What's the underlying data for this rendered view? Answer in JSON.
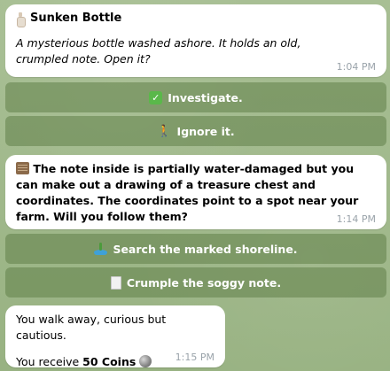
{
  "messages": [
    {
      "title": "Sunken Bottle",
      "text": "A mysterious bottle washed ashore. It holds an old, crumpled note. Open it?",
      "time": "1:04 PM",
      "icon": "bottle-icon"
    },
    {
      "text": "The note inside is partially water-damaged but you can make out a drawing of a treasure chest and coordinates. The coordinates point to a spot near your farm. Will you follow them?",
      "time": "1:14 PM",
      "icon": "scroll-icon"
    },
    {
      "line1": "You walk away, curious but cautious.",
      "line2_prefix": "You receive ",
      "line2_bold": "50 Coins",
      "time": "1:15 PM",
      "icon": "coin-icon"
    }
  ],
  "buttons": [
    {
      "label": "Investigate.",
      "icon": "check-icon"
    },
    {
      "label": "Ignore it.",
      "icon": "walking-person-icon"
    },
    {
      "label": "Search the marked shoreline.",
      "icon": "island-icon"
    },
    {
      "label": "Crumple the soggy note.",
      "icon": "page-icon"
    }
  ],
  "colors": {
    "background": "#9db689",
    "bubble": "#ffffff",
    "button": "#6a8a55",
    "time": "#9aa3aa",
    "check": "#5ab84a"
  }
}
